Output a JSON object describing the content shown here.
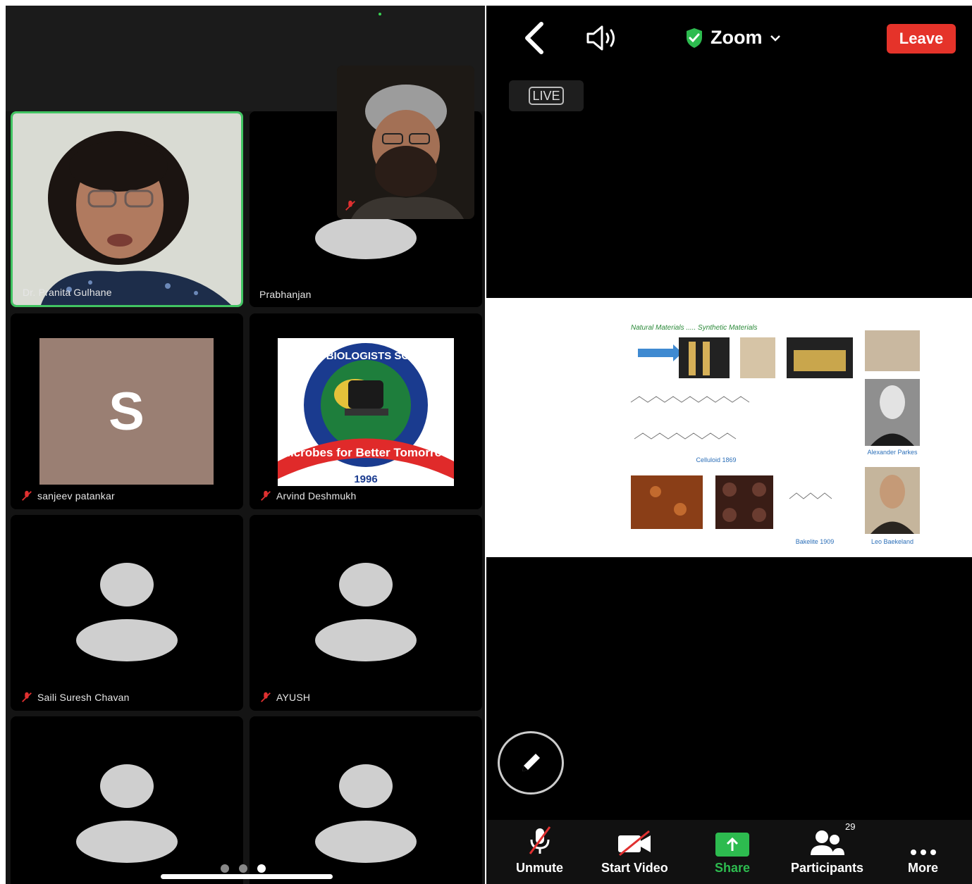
{
  "left_panel": {
    "participants": [
      {
        "name": "Dr. Pranita Gulhane",
        "muted": false,
        "active_speaker": true
      },
      {
        "name": "Prabhanjan",
        "muted": false
      },
      {
        "name": "sanjeev patankar",
        "muted": true,
        "initial": "S",
        "initial_bg": "#9a7f73"
      },
      {
        "name": "Arvind Deshmukh",
        "muted": true
      },
      {
        "name": "Saili Suresh Chavan",
        "muted": true
      },
      {
        "name": "AYUSH",
        "muted": true
      }
    ],
    "page_count": 3,
    "current_page": 3
  },
  "logo": {
    "top_text": "MICROBIOLOGISTS SOCIETY",
    "ribbon_text": "Microbes for Better Tomorrow",
    "year": "1996"
  },
  "header": {
    "app_title": "Zoom",
    "leave_label": "Leave",
    "live_badge": "LIVE"
  },
  "slide": {
    "title": "Natural Materials ..... Synthetic Materials",
    "cellulose_caption": "Celluloid 1869",
    "bakelite_caption": "Bakelite 1909",
    "parkes_caption": "Alexander Parkes",
    "baekeland_caption": "Leo Baekeland"
  },
  "toolbar": {
    "unmute_label": "Unmute",
    "start_video_label": "Start Video",
    "share_label": "Share",
    "participants_label": "Participants",
    "participants_count": "29",
    "more_label": "More"
  },
  "colors": {
    "leave_red": "#e5332a",
    "share_green": "#2dbb4f",
    "active_border": "#41c462",
    "mute_red": "#e03030"
  }
}
